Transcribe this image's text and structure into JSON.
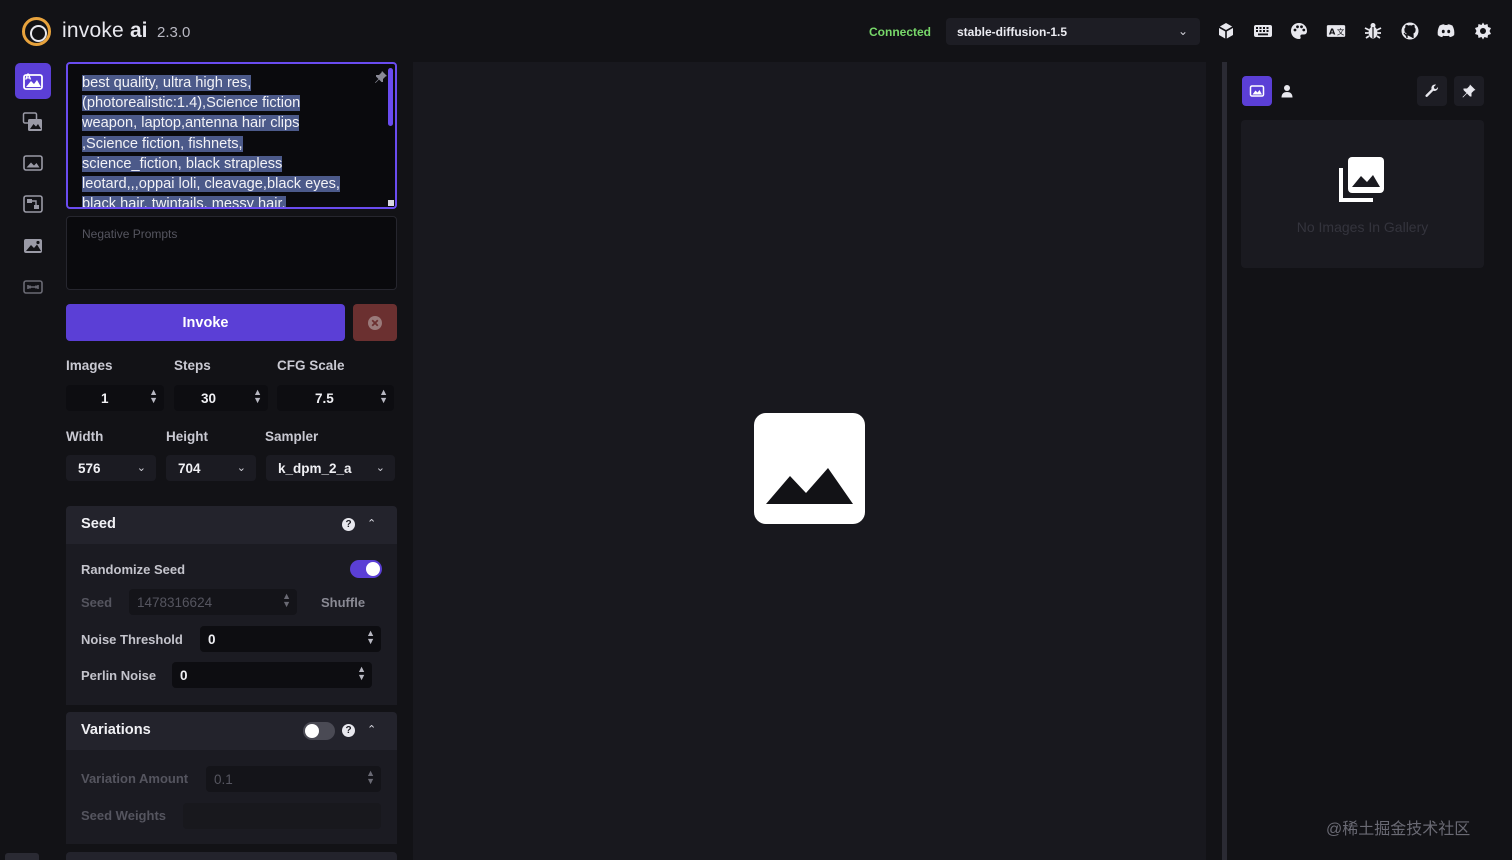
{
  "header": {
    "app_name": "invoke",
    "app_name_bold": "ai",
    "version": "2.3.0",
    "status": "Connected",
    "model": "stable-diffusion-1.5",
    "icons": [
      "model-manager-icon",
      "keyboard-icon",
      "palette-icon",
      "language-icon",
      "bug-icon",
      "github-icon",
      "discord-icon",
      "settings-icon"
    ]
  },
  "rail": {
    "items": [
      "text-to-image-icon",
      "image-to-image-icon",
      "unified-canvas-icon",
      "nodes-icon",
      "postprocessing-icon",
      "training-icon"
    ]
  },
  "prompt": {
    "lines": [
      "best quality, ultra high res,",
      "(photorealistic:1.4),Science fiction",
      "weapon,  laptop,antenna hair clips",
      ",Science fiction,  fishnets,",
      "science_fiction,  black strapless",
      "leotard,,,oppai loli,  cleavage,black eyes,",
      "black  hair,  twintails,   messy hair,"
    ],
    "negative_placeholder": "Negative Prompts"
  },
  "actions": {
    "invoke_label": "Invoke"
  },
  "params": {
    "images_label": "Images",
    "images_value": "1",
    "steps_label": "Steps",
    "steps_value": "30",
    "cfg_label": "CFG Scale",
    "cfg_value": "7.5",
    "width_label": "Width",
    "width_value": "576",
    "height_label": "Height",
    "height_value": "704",
    "sampler_label": "Sampler",
    "sampler_value": "k_dpm_2_a"
  },
  "seed": {
    "title": "Seed",
    "randomize_label": "Randomize Seed",
    "randomize_on": true,
    "seed_label": "Seed",
    "seed_value": "1478316624",
    "shuffle_label": "Shuffle",
    "noise_label": "Noise Threshold",
    "noise_value": "0",
    "perlin_label": "Perlin Noise",
    "perlin_value": "0"
  },
  "variations": {
    "title": "Variations",
    "enabled": false,
    "amount_label": "Variation Amount",
    "amount_value": "0.1",
    "weights_label": "Seed Weights"
  },
  "gallery": {
    "empty_text": "No Images In Gallery"
  },
  "watermark": "@稀土掘金技术社区",
  "colors": {
    "accent": "#5b3fd6",
    "connected": "#78d86a",
    "logo": "#e8a33d",
    "cancel": "#6b3030"
  }
}
